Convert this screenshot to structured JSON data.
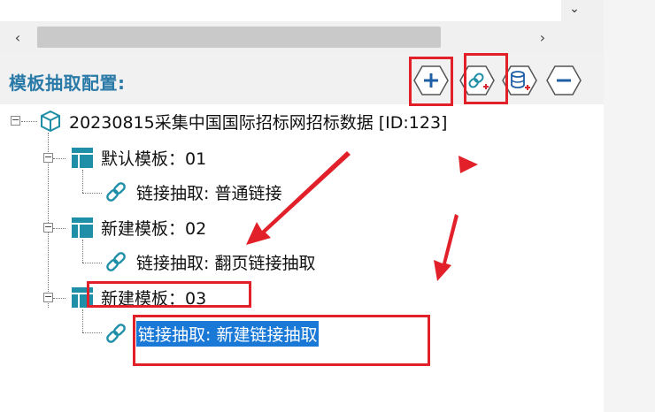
{
  "panel": {
    "title": "模板抽取配置:"
  },
  "toolbar": {
    "add_symbol": "+",
    "remove_symbol": "−",
    "buttons": [
      {
        "name": "add-button",
        "icon": "plus-icon"
      },
      {
        "name": "add-link-extract-button",
        "icon": "link-plus-icon"
      },
      {
        "name": "add-data-extract-button",
        "icon": "database-plus-icon"
      },
      {
        "name": "remove-button",
        "icon": "minus-icon"
      }
    ]
  },
  "tree": {
    "root": {
      "label": "20230815采集中国国际招标网招标数据 [ID:123]",
      "icon": "cube-icon",
      "expander": "−"
    },
    "templates": [
      {
        "label": "默认模板：01",
        "expander": "−",
        "children": [
          {
            "label": "链接抽取: 普通链接"
          }
        ]
      },
      {
        "label": "新建模板：02",
        "expander": "−",
        "children": [
          {
            "label": "链接抽取: 翻页链接抽取"
          }
        ]
      },
      {
        "label": "新建模板：03",
        "expander": "−",
        "children": [
          {
            "label": "链接抽取: 新建链接抽取",
            "selected": true
          }
        ]
      }
    ]
  },
  "scrollbar": {
    "left_glyph": "‹",
    "right_glyph": "›",
    "down_glyph": "⌄"
  },
  "colors": {
    "title": "#2a7aa8",
    "annotation_red": "#e2202a",
    "selection": "#1a78d6",
    "icon_teal": "#1f8ea7"
  }
}
